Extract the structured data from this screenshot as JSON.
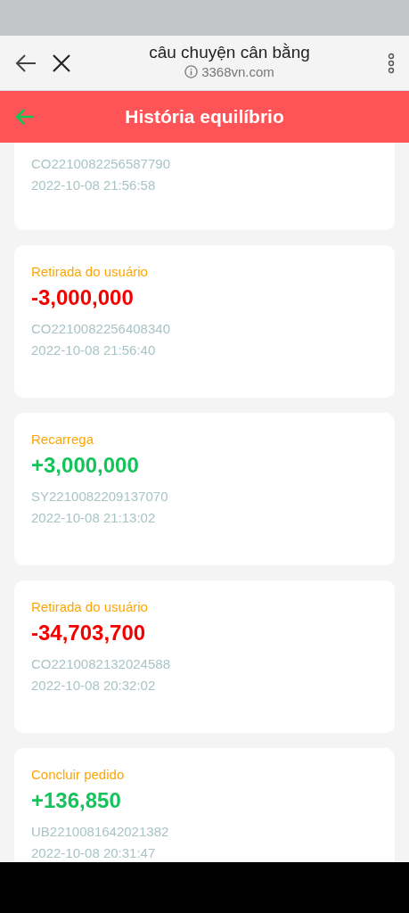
{
  "browser": {
    "title": "câu chuyện cân bằng",
    "url": "3368vn.com"
  },
  "header": {
    "title": "História equilíbrio"
  },
  "transactions": [
    {
      "partial": true,
      "code": "CO2210082256587790",
      "time": "2022-10-08 21:56:58"
    },
    {
      "label": "Retirada do usuário",
      "amount": "-3,000,000",
      "kind": "debit",
      "code": "CO2210082256408340",
      "time": "2022-10-08 21:56:40"
    },
    {
      "label": "Recarrega",
      "amount": "+3,000,000",
      "kind": "credit",
      "code": "SY2210082209137070",
      "time": "2022-10-08 21:13:02"
    },
    {
      "label": "Retirada do usuário",
      "amount": "-34,703,700",
      "kind": "debit",
      "code": "CO2210082132024588",
      "time": "2022-10-08 20:32:02"
    },
    {
      "label": "Concluir pedido",
      "amount": "+136,850",
      "kind": "credit",
      "code": "UB2210081642021382",
      "time": "2022-10-08 20:31:47"
    }
  ]
}
